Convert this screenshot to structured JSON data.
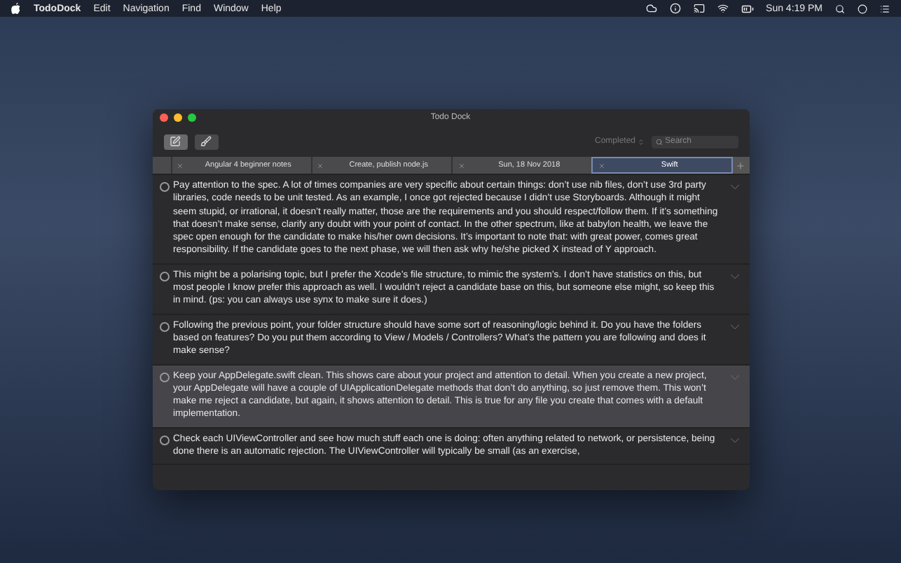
{
  "menu_bar": {
    "app_name": "TodoDock",
    "menus": [
      "Edit",
      "Navigation",
      "Find",
      "Window",
      "Help"
    ],
    "clock": "Sun 4:19 PM"
  },
  "window": {
    "title": "Todo Dock"
  },
  "toolbar": {
    "buttons": [
      {
        "kind": "compose",
        "selected": true
      },
      {
        "kind": "broom",
        "selected": false
      }
    ],
    "filter": "Completed",
    "search": {
      "placeholder": "Search"
    }
  },
  "tabs": [
    {
      "label": "Angular 4 beginner notes",
      "selected": false
    },
    {
      "label": "Create, publish node.js",
      "selected": false
    },
    {
      "label": "Sun, 18 Nov 2018",
      "selected": false
    },
    {
      "label": "Swift",
      "selected": true
    }
  ],
  "todos": [
    {
      "text": "Pay attention to the spec. A lot of times companies are very specific about certain things: don’t use nib files, don’t use 3rd party libraries, code needs to be unit tested. As an example, I once got rejected because I didn’t use Storyboards. Although it might seem stupid, or irrational, it doesn’t really matter, those are the requirements and you should respect/follow them. If it’s something that doesn’t make sense, clarify any doubt with your point of contact. In the other spectrum, like at babylon health, we leave the spec open enough for the candidate to make his/her own decisions. It’s important to note that: with great power, comes great responsibility. If the candidate goes to the next phase, we will then ask why he/she picked X instead of Y approach.",
      "checked": false,
      "selected": false
    },
    {
      "text": "This might be a polarising topic, but I prefer the Xcode’s file structure, to mimic the system’s. I don’t have statistics on this, but most people I know prefer this approach as well. I wouldn’t reject a candidate base on this, but someone else might, so keep this in mind. (ps: you can always use synx to make sure it does.)",
      "checked": false,
      "selected": false
    },
    {
      "text": "Following the previous point, your folder structure should have some sort of reasoning/logic behind it. Do you have the folders based on features? Do you put them according to View / Models / Controllers? What’s the pattern you are following and does it make sense?",
      "checked": false,
      "selected": false
    },
    {
      "text": "Keep your AppDelegate.swift clean. This shows care about your project and attention to detail. When you create a new project, your AppDelegate will have a couple of UIApplicationDelegate methods that don’t do anything, so just remove them. This won’t make me reject a candidate, but again, it shows attention to detail. This is true for any file you create that comes with a default implementation.",
      "checked": false,
      "selected": true
    },
    {
      "text": "Check each UIViewController and see how much stuff each one is doing: often anything related to network, or persistence, being done there is an automatic rejection. The UIViewController will typically be small (as an exercise,",
      "checked": false,
      "selected": false
    }
  ]
}
